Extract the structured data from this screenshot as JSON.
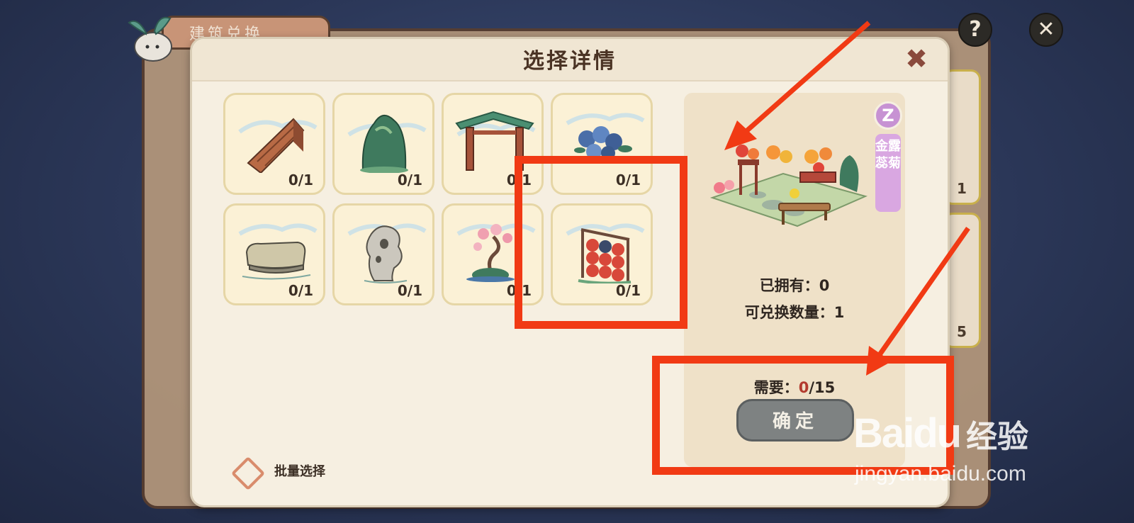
{
  "background": {
    "tab_title": "建筑兑换",
    "right_card_values": [
      "1",
      "5"
    ]
  },
  "dialog": {
    "title": "选择详情",
    "close_icon": "close-x"
  },
  "items": [
    {
      "name": "wooden-ramp",
      "count": "0/1"
    },
    {
      "name": "green-mountain",
      "count": "0/1"
    },
    {
      "name": "green-gate",
      "count": "0/1"
    },
    {
      "name": "blue-flowers",
      "count": "0/1"
    },
    {
      "name": "stone-slab",
      "count": "0/1"
    },
    {
      "name": "taihu-rock",
      "count": "0/1"
    },
    {
      "name": "blossom-bonsai",
      "count": "0/1"
    },
    {
      "name": "lantern-rack",
      "count": "0/1"
    }
  ],
  "batch_select": {
    "label": "批量选择"
  },
  "detail": {
    "rarity": "Z",
    "name": "金露蕊菊",
    "owned_label": "已拥有：",
    "owned_value": "0",
    "exchange_label": "可兑换数量：",
    "exchange_value": "1",
    "require_label": "需要：",
    "require_current": "0",
    "require_total": "/15",
    "confirm_label": "确定"
  },
  "watermark": {
    "logo": "Baidu",
    "cn": "经验",
    "url": "jingyan.baidu.com"
  },
  "colors": {
    "annotation_red": "#f13a14",
    "rarity_purple": "#c792d3",
    "require_red": "#b33b2e"
  }
}
